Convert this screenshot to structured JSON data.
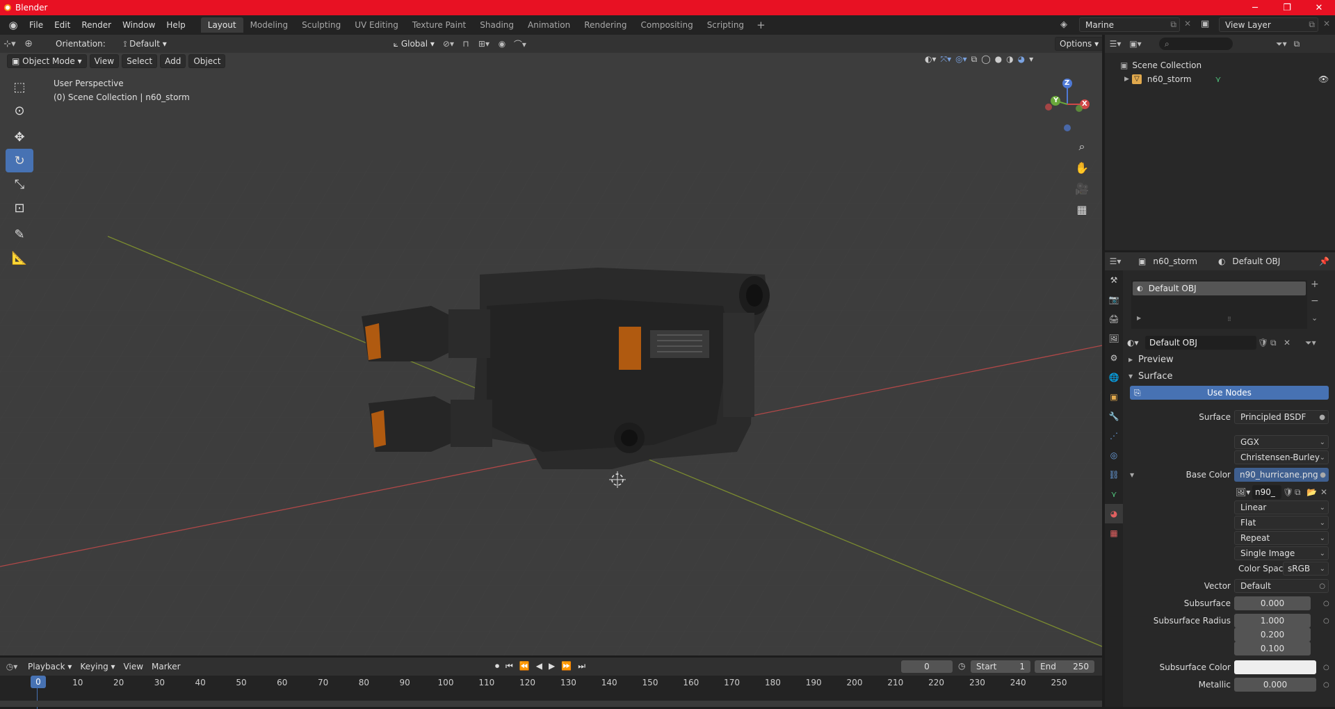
{
  "window": {
    "title": "Blender",
    "controls": [
      "─",
      "❐",
      "✕"
    ]
  },
  "menu": [
    "File",
    "Edit",
    "Render",
    "Window",
    "Help"
  ],
  "workspaces": [
    {
      "label": "Layout",
      "active": true
    },
    {
      "label": "Modeling"
    },
    {
      "label": "Sculpting"
    },
    {
      "label": "UV Editing"
    },
    {
      "label": "Texture Paint"
    },
    {
      "label": "Shading"
    },
    {
      "label": "Animation"
    },
    {
      "label": "Rendering"
    },
    {
      "label": "Compositing"
    },
    {
      "label": "Scripting"
    }
  ],
  "scene": {
    "name": "Marine",
    "view_layer": "View Layer"
  },
  "viewport": {
    "orientation_label": "Orientation:",
    "orientation_value": "Default",
    "transform_space": "Global",
    "options_label": "Options",
    "mode": "Object Mode",
    "menus": [
      "View",
      "Select",
      "Add",
      "Object"
    ],
    "perspective": "User Perspective",
    "collection_info": "(0) Scene Collection | n60_storm",
    "gizmo": {
      "x": "X",
      "y": "Y",
      "z": "Z"
    }
  },
  "outliner": {
    "root": "Scene Collection",
    "items": [
      {
        "label": "n60_storm"
      }
    ]
  },
  "properties": {
    "object_name": "n60_storm",
    "material_name": "Default OBJ",
    "slot": "Default OBJ",
    "material_field": "Default OBJ",
    "panels": {
      "preview": "Preview",
      "surface": "Surface"
    },
    "use_nodes": "Use Nodes",
    "rows": {
      "surface": {
        "label": "Surface",
        "value": "Principled BSDF"
      },
      "distribution": "GGX",
      "subsurface_method": "Christensen-Burley",
      "base_color": {
        "label": "Base Color",
        "value": "n90_hurricane.png"
      },
      "image_name": "n90_",
      "interpolation": "Linear",
      "projection": "Flat",
      "extension": "Repeat",
      "source": "Single Image",
      "color_space": {
        "label": "Color Spac",
        "value": "sRGB"
      },
      "vector": {
        "label": "Vector",
        "value": "Default"
      },
      "subsurface": {
        "label": "Subsurface",
        "value": "0.000"
      },
      "subsurface_radius": {
        "label": "Subsurface Radius",
        "values": [
          "1.000",
          "0.200",
          "0.100"
        ]
      },
      "subsurface_color": {
        "label": "Subsurface Color"
      },
      "metallic": {
        "label": "Metallic",
        "value": "0.000"
      }
    }
  },
  "timeline": {
    "menus": [
      "Playback",
      "Keying",
      "View",
      "Marker"
    ],
    "current_frame": "0",
    "start_label": "Start",
    "start": "1",
    "end_label": "End",
    "end": "250",
    "ruler": [
      "0",
      "10",
      "20",
      "30",
      "40",
      "50",
      "60",
      "70",
      "80",
      "90",
      "100",
      "110",
      "120",
      "130",
      "140",
      "150",
      "160",
      "170",
      "180",
      "190",
      "200",
      "210",
      "220",
      "230",
      "240",
      "250"
    ]
  }
}
